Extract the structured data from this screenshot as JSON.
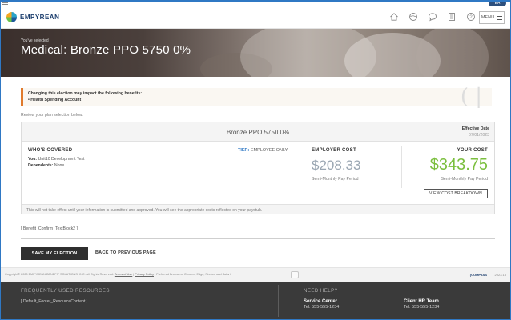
{
  "window": {
    "badge": "EA"
  },
  "header": {
    "logo_text": "EMPYREAN",
    "icons": [
      "home-icon",
      "globe-icon",
      "chat-icon",
      "document-icon",
      "help-icon"
    ],
    "menu_label": "MENU"
  },
  "hero": {
    "subtitle": "You've selected",
    "title": "Medical: Bronze PPO 5750 0%"
  },
  "notice": {
    "title": "Changing this election may impact the following benefits:",
    "items": [
      "Health Spending Account"
    ]
  },
  "review_text": "Review your plan selection below.",
  "plan": {
    "name": "Bronze PPO 5750 0%",
    "effective_label": "Effective Date",
    "effective_date": "07/01/2023",
    "who_covered_label": "WHO'S COVERED",
    "tier_label": "TIER:",
    "tier_value": "EMPLOYEE ONLY",
    "you_label": "You:",
    "you_value": "Unit10 Development Test",
    "dependents_label": "Dependents:",
    "dependents_value": "None",
    "employer_cost_label": "EMPLOYER COST",
    "employer_cost": "$208.33",
    "employer_period": "Semi-Monthly Pay Period",
    "your_cost_label": "YOUR COST",
    "your_cost": "$343.75",
    "your_period": "Semi-Monthly Pay Period",
    "view_breakdown": "VIEW COST BREAKDOWN",
    "footer_note": "This will not take effect until your information is submitted and approved. You will see the appropriate costs reflected on your paystub."
  },
  "text_block": "[ Benefit_Confirm_TextBlock2 ]",
  "actions": {
    "save": "SAVE MY ELECTION",
    "back": "BACK TO PREVIOUS PAGE"
  },
  "copyright": {
    "text": "Copyright© 2023 EMPYREAN BENEFIT SOLUTIONS, INC. All Rights Reserved.",
    "terms": "Terms of Use",
    "privacy": "Privacy Policy",
    "browsers": "Preferred Browsers: Chrome, Edge, Firefox, and Safari",
    "badge": "(COMPASS",
    "version": "2023.15"
  },
  "footer": {
    "resources_title": "FREQUENTLY USED RESOURCES",
    "resources_content": "[ Default_Footer_ResourceContent ]",
    "help_title": "NEED HELP?",
    "service_center_name": "Service Center",
    "service_center_tel": "Tel. 555-555-1234",
    "hr_team_name": "Client HR Team",
    "hr_team_tel": "Tel. 555-555-1234"
  }
}
